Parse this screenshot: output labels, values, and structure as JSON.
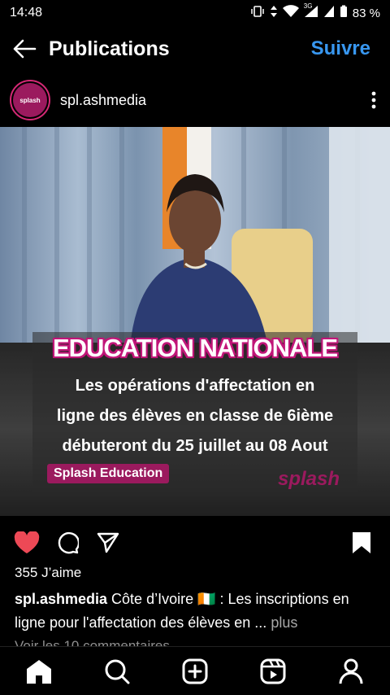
{
  "status_bar": {
    "time": "14:48",
    "network": "3G",
    "battery": "83 %"
  },
  "header": {
    "title": "Publications",
    "follow_label": "Suivre",
    "back_icon": "arrow-left-icon"
  },
  "post": {
    "username": "spl.ashmedia",
    "avatar_text": "splash",
    "image": {
      "headline": "EDUCATION NATIONALE",
      "body_lines": [
        "Les opérations d'affectation en",
        "ligne des élèves en classe de 6ième",
        "débuteront du 25 juillet au 08 Aout"
      ],
      "tag": "Splash Education",
      "watermark": "splash"
    },
    "likes": "355 J’aime",
    "caption_user": "spl.ashmedia",
    "caption_text": " Côte d’Ivoire 🇨🇮 : Les inscriptions en ligne pour l'affectation des élèves en ...",
    "caption_more": " plus",
    "comments_text": "Voir les 10 commentaires"
  },
  "colors": {
    "accent": "#3897f0",
    "like": "#ed4956",
    "brand": "#9b1a5e"
  }
}
